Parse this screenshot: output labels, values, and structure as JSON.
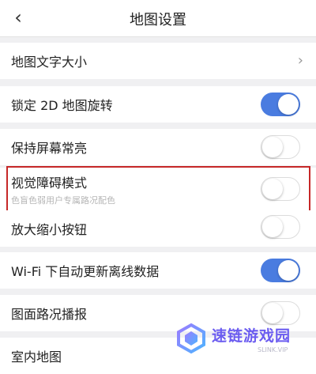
{
  "header": {
    "title": "地图设置",
    "back_icon": "chevron-left-icon"
  },
  "settings": {
    "map_text_size": {
      "label": "地图文字大小"
    },
    "lock_2d_rotation": {
      "label": "锁定 2D 地图旋转",
      "enabled": true
    },
    "keep_screen_on": {
      "label": "保持屏幕常亮",
      "enabled": false
    },
    "visual_impairment_mode": {
      "label": "视觉障碍模式",
      "description": "色盲色弱用户专属路况配色",
      "enabled": false
    },
    "zoom_buttons": {
      "label": "放大缩小按钮",
      "enabled": false
    },
    "wifi_auto_update": {
      "label": "Wi-Fi 下自动更新离线数据",
      "enabled": true
    },
    "traffic_broadcast": {
      "label": "图面路况播报",
      "enabled": false
    },
    "indoor_map": {
      "label": "室内地图"
    }
  },
  "watermark": {
    "text": "速链游戏园",
    "subtext": "SLINK.VIP"
  },
  "colors": {
    "toggle_on": "#4a7ce0",
    "highlight_border": "#c62828",
    "background": "#f0f0f2"
  }
}
